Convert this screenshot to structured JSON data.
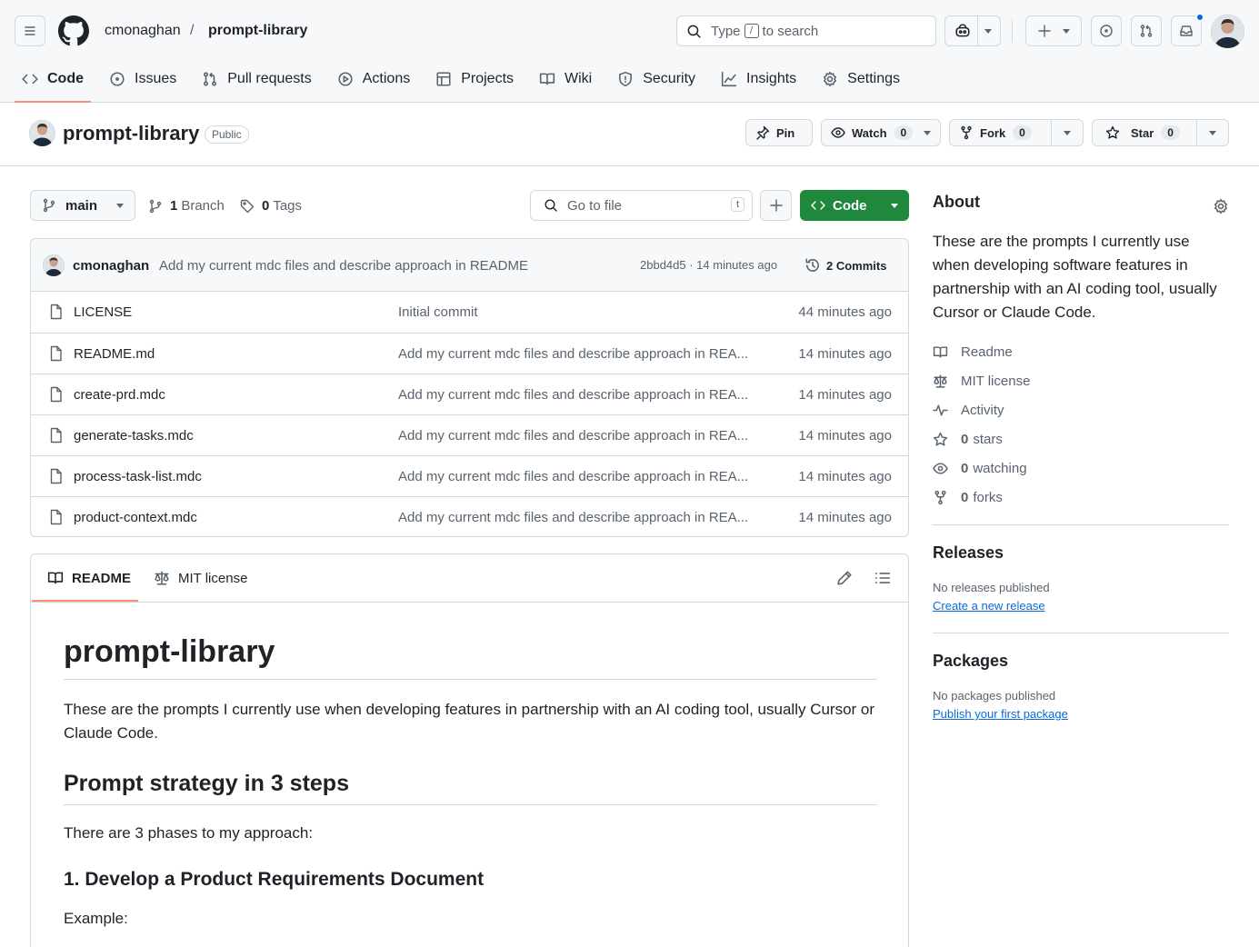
{
  "header": {
    "owner": "cmonaghan",
    "separator": "/",
    "repo": "prompt-library",
    "search_pre": "Type",
    "search_key": "/",
    "search_post": "to search"
  },
  "tabs": [
    {
      "label": "Code",
      "icon": "code-icon",
      "active": true
    },
    {
      "label": "Issues",
      "icon": "issue-icon"
    },
    {
      "label": "Pull requests",
      "icon": "pull-request-icon"
    },
    {
      "label": "Actions",
      "icon": "play-icon"
    },
    {
      "label": "Projects",
      "icon": "table-icon"
    },
    {
      "label": "Wiki",
      "icon": "book-icon"
    },
    {
      "label": "Security",
      "icon": "shield-icon"
    },
    {
      "label": "Insights",
      "icon": "graph-icon"
    },
    {
      "label": "Settings",
      "icon": "gear-icon"
    }
  ],
  "repo": {
    "name": "prompt-library",
    "visibility": "Public",
    "pin_label": "Pin",
    "watch_label": "Watch",
    "watch_count": "0",
    "fork_label": "Fork",
    "fork_count": "0",
    "star_label": "Star",
    "star_count": "0"
  },
  "toolbar": {
    "branch": "main",
    "branch_count": "1",
    "branch_label": "Branch",
    "tag_count": "0",
    "tag_label": "Tags",
    "goto_placeholder": "Go to file",
    "goto_key": "t",
    "code_label": "Code"
  },
  "commit": {
    "author": "cmonaghan",
    "message": "Add my current mdc files and describe approach in README",
    "hash_time": "2bbd4d5 · 14 minutes ago",
    "commits_label": "2 Commits"
  },
  "files": [
    {
      "name": "LICENSE",
      "message": "Initial commit",
      "age": "44 minutes ago"
    },
    {
      "name": "README.md",
      "message": "Add my current mdc files and describe approach in REA...",
      "age": "14 minutes ago"
    },
    {
      "name": "create-prd.mdc",
      "message": "Add my current mdc files and describe approach in REA...",
      "age": "14 minutes ago"
    },
    {
      "name": "generate-tasks.mdc",
      "message": "Add my current mdc files and describe approach in REA...",
      "age": "14 minutes ago"
    },
    {
      "name": "process-task-list.mdc",
      "message": "Add my current mdc files and describe approach in REA...",
      "age": "14 minutes ago"
    },
    {
      "name": "product-context.mdc",
      "message": "Add my current mdc files and describe approach in REA...",
      "age": "14 minutes ago"
    }
  ],
  "readme": {
    "tab_readme": "README",
    "tab_license": "MIT license",
    "h1": "prompt-library",
    "intro": "These are the prompts I currently use when developing features in partnership with an AI coding tool, usually Cursor or Claude Code.",
    "h2": "Prompt strategy in 3 steps",
    "p2": "There are 3 phases to my approach:",
    "h3": "1. Develop a Product Requirements Document",
    "p3": "Example:"
  },
  "sidebar": {
    "about_title": "About",
    "about_desc": "These are the prompts I currently use when developing software features in partnership with an AI coding tool, usually Cursor or Claude Code.",
    "readme": "Readme",
    "license": "MIT license",
    "activity": "Activity",
    "stars_count": "0",
    "stars_label": "stars",
    "watching_count": "0",
    "watching_label": "watching",
    "forks_count": "0",
    "forks_label": "forks",
    "releases_title": "Releases",
    "releases_none": "No releases published",
    "releases_link": "Create a new release",
    "packages_title": "Packages",
    "packages_none": "No packages published",
    "packages_link": "Publish your first package"
  },
  "colors": {
    "accent_green": "#1f883d",
    "link_blue": "#0969da",
    "tab_underline": "#fd8c73"
  }
}
